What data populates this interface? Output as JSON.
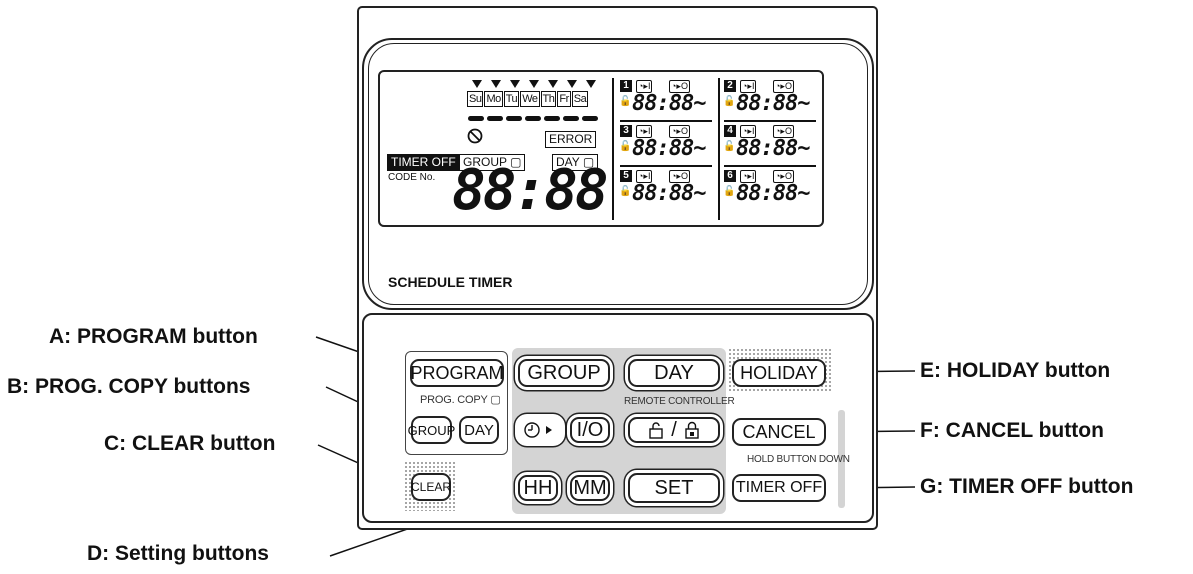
{
  "device": {
    "title": "SCHEDULE TIMER",
    "lcd": {
      "days": [
        "Su",
        "Mo",
        "Tu",
        "We",
        "Th",
        "Fr",
        "Sa"
      ],
      "error": "ERROR",
      "timer_off": "TIMER OFF",
      "group": "GROUP",
      "day": "DAY",
      "code_no": "CODE No.",
      "big_digits": "88:88",
      "small_digits": "88:88",
      "tilde": "~",
      "slots": [
        "1",
        "2",
        "3",
        "4",
        "5",
        "6"
      ]
    },
    "buttons": {
      "program": "PROGRAM",
      "prog_copy_label": "PROG. COPY",
      "copy_group": "GROUP",
      "copy_day": "DAY",
      "clear": "CLEAR",
      "group": "GROUP",
      "day": "DAY",
      "holiday": "HOLIDAY",
      "remote_controller": "REMOTE CONTROLLER",
      "io": "I/O",
      "lock": "/",
      "cancel": "CANCEL",
      "hold_button_down": "HOLD BUTTON DOWN",
      "hh": "HH",
      "mm": "MM",
      "set": "SET",
      "timer_off": "TIMER OFF"
    }
  },
  "callouts": {
    "a": "A: PROGRAM button",
    "b": "B: PROG. COPY buttons",
    "c": "C: CLEAR button",
    "d": "D: Setting buttons",
    "e": "E: HOLIDAY button",
    "f": "F: CANCEL button",
    "g": "G: TIMER OFF button"
  }
}
